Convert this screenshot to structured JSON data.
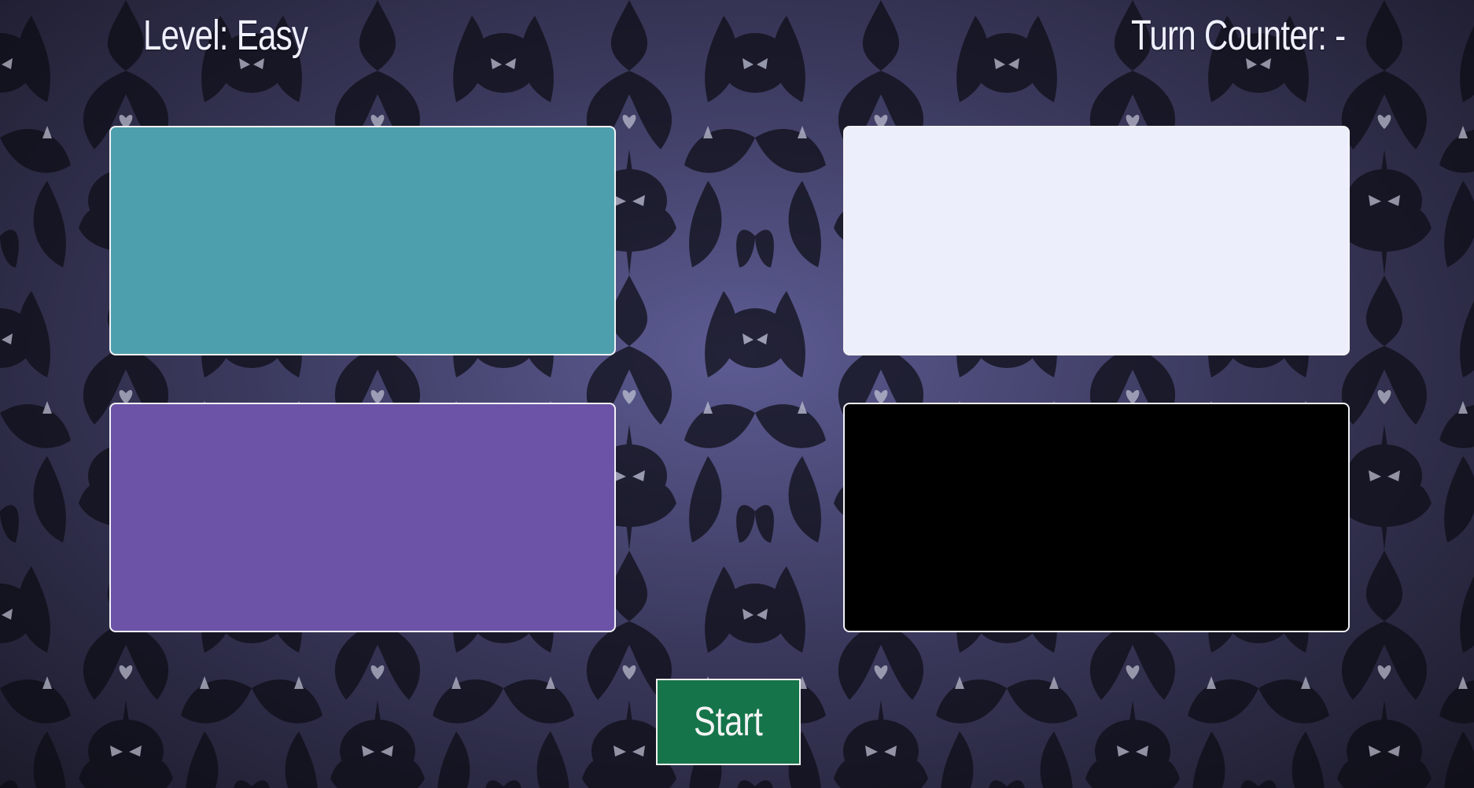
{
  "hud": {
    "level_text": "Level: Easy",
    "turn_text": "Turn Counter: -"
  },
  "pads": [
    {
      "id": "teal",
      "color": "#4e9fae"
    },
    {
      "id": "white",
      "color": "#eceefb"
    },
    {
      "id": "purple",
      "color": "#6c53a7"
    },
    {
      "id": "black",
      "color": "#000000"
    }
  ],
  "start_button": {
    "label": "Start",
    "color": "#16744a"
  },
  "theme": {
    "wallpaper_base": "#3c3b5e",
    "pattern_color": "#0b0b14",
    "accent_light": "#c9cbdb"
  }
}
